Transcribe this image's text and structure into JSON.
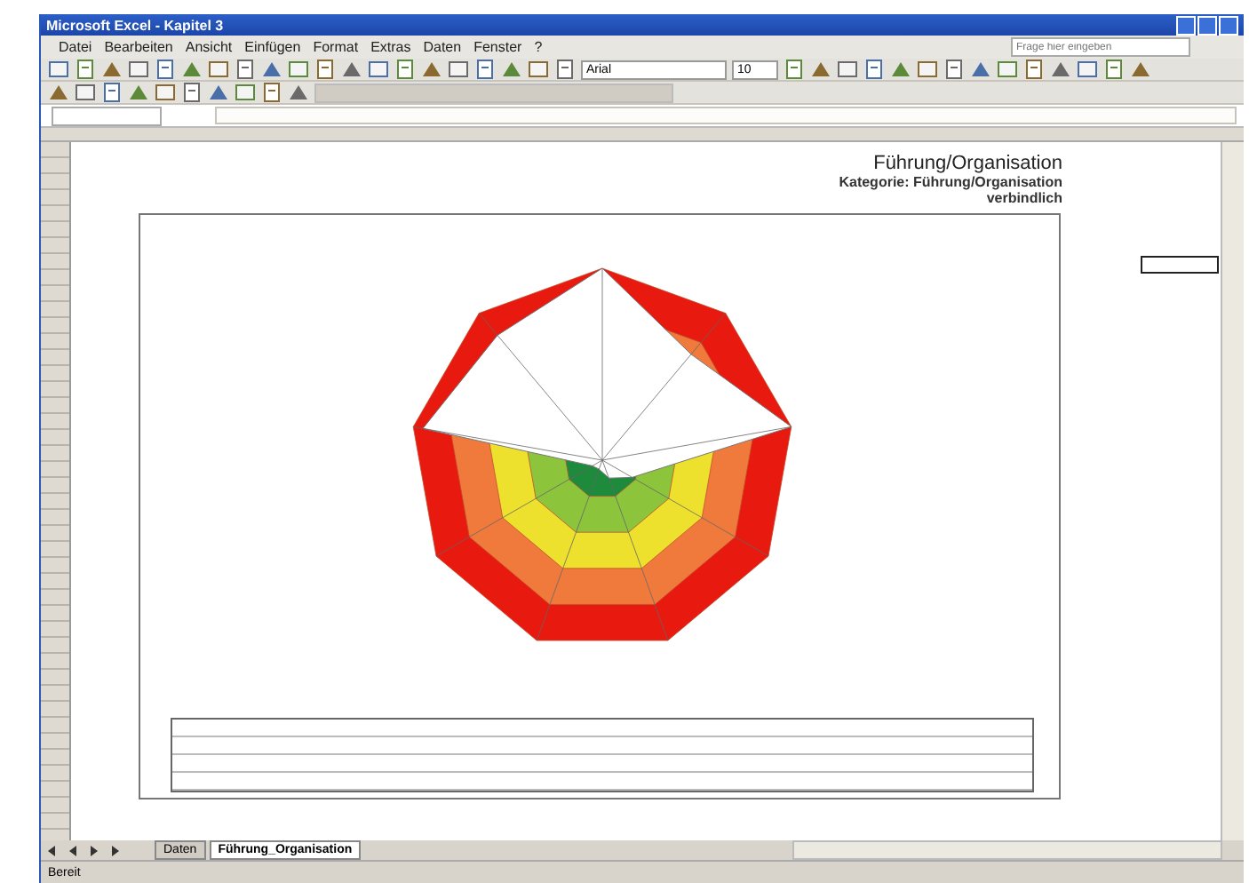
{
  "window": {
    "title": "Microsoft Excel - Kapitel 3"
  },
  "menu": [
    "Datei",
    "Bearbeiten",
    "Ansicht",
    "Einfügen",
    "Format",
    "Extras",
    "Daten",
    "Fenster",
    "?"
  ],
  "help_box": {
    "placeholder": "Frage hier eingeben"
  },
  "toolbar": {
    "font": "Arial",
    "size": "10"
  },
  "sheet": {
    "heading": "Führung/Organisation",
    "category": "Kategorie: Führung/Organisation",
    "note": "verbindlich"
  },
  "sheet_tabs": [
    {
      "label": "Daten",
      "selected": false
    },
    {
      "label": "Führung_Organisation",
      "selected": true
    }
  ],
  "status_bar": "Bereit"
}
